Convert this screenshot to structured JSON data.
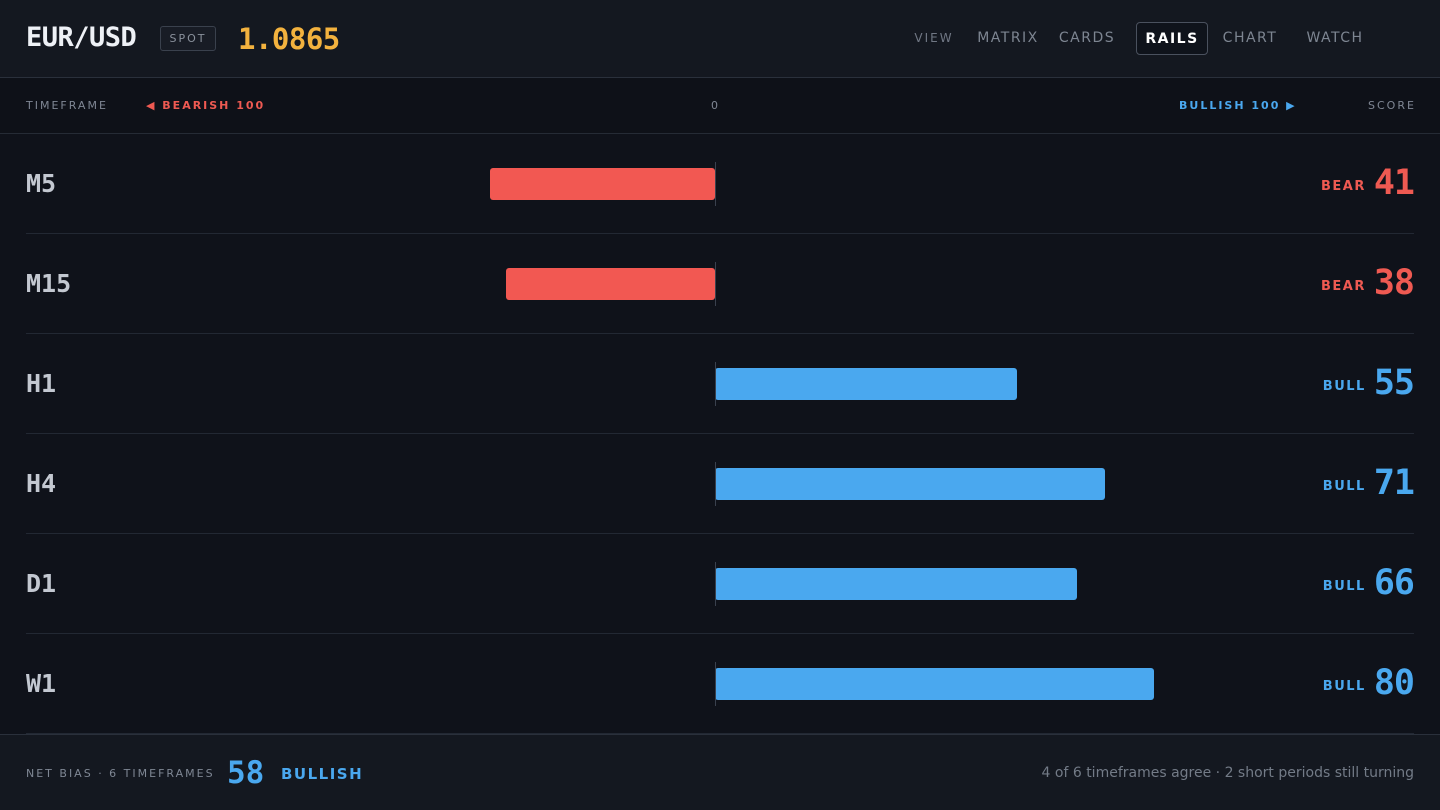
{
  "header": {
    "pair": "EUR/USD",
    "badge": "SPOT",
    "price": "1.0865",
    "nav": {
      "view_label": "VIEW",
      "items": [
        "MATRIX",
        "CARDS",
        "RAILS",
        "CHART",
        "WATCH"
      ],
      "active": "RAILS"
    }
  },
  "columns": {
    "timeframe": "TIMEFRAME",
    "bearish": "◀ BEARISH 100",
    "zero": "0",
    "bullish": "BULLISH 100 ▶",
    "score": "SCORE"
  },
  "rows": [
    {
      "tf": "M5",
      "direction": "BEAR",
      "score": 41,
      "fill_fraction": 0.41
    },
    {
      "tf": "M15",
      "direction": "BEAR",
      "score": 38,
      "fill_fraction": 0.38
    },
    {
      "tf": "H1",
      "direction": "BULL",
      "score": 55,
      "fill_fraction": 0.55
    },
    {
      "tf": "H4",
      "direction": "BULL",
      "score": 71,
      "fill_fraction": 0.71
    },
    {
      "tf": "D1",
      "direction": "BULL",
      "score": 66,
      "fill_fraction": 0.66
    },
    {
      "tf": "W1",
      "direction": "BULL",
      "score": 80,
      "fill_fraction": 0.8
    }
  ],
  "footer": {
    "net_label": "NET BIAS · 6 TIMEFRAMES",
    "net_value": "58",
    "net_direction": "BULLISH",
    "summary": "4 of 6 timeframes agree · 2 short periods still turning"
  },
  "colors": {
    "bear": "#f25852",
    "bull": "#4aa8ef",
    "price": "#f3b23e",
    "background": "#0f121a"
  }
}
